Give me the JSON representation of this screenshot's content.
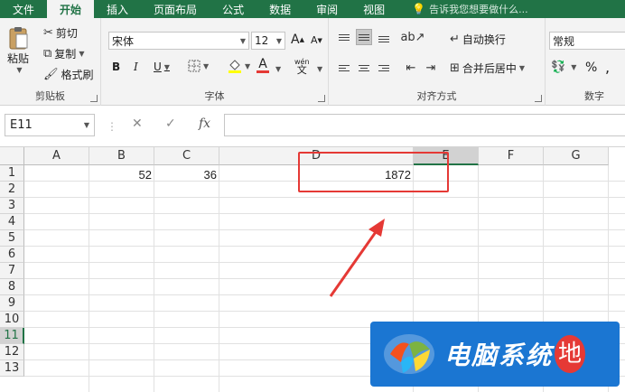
{
  "tabs": [
    "文件",
    "开始",
    "插入",
    "页面布局",
    "公式",
    "数据",
    "审阅",
    "视图"
  ],
  "active_tab": "开始",
  "tell_me": "告诉我您想要做什么...",
  "clipboard": {
    "paste": "粘贴",
    "cut": "剪切",
    "copy": "复制",
    "format_painter": "格式刷",
    "label": "剪贴板"
  },
  "font": {
    "name": "宋体",
    "size": "12",
    "grow": "A",
    "shrink": "A",
    "bold": "B",
    "italic": "I",
    "underline": "U",
    "color_letter": "A",
    "label": "字体"
  },
  "alignment": {
    "wrap": "自动换行",
    "merge": "合并后居中",
    "label": "对齐方式"
  },
  "number": {
    "format": "常规",
    "percent": "%",
    "comma": ",",
    "label": "数字"
  },
  "formula_bar": {
    "name_box": "E11",
    "cancel": "✕",
    "enter": "✓",
    "fx": "fx",
    "value": ""
  },
  "columns": [
    "A",
    "B",
    "C",
    "D",
    "E",
    "F",
    "G"
  ],
  "selected_column": "E",
  "rows": [
    "1",
    "2",
    "3",
    "4",
    "5",
    "6",
    "7",
    "8",
    "9",
    "10",
    "11",
    "12",
    "13"
  ],
  "selected_row": "11",
  "cells": {
    "B1": "52",
    "C1": "36",
    "D1": "1872"
  },
  "watermark": {
    "text": "电脑系统",
    "end": "地"
  },
  "colors": {
    "ribbon_green": "#217346",
    "highlight_red": "#e53935",
    "watermark_blue": "#1b76d2"
  }
}
